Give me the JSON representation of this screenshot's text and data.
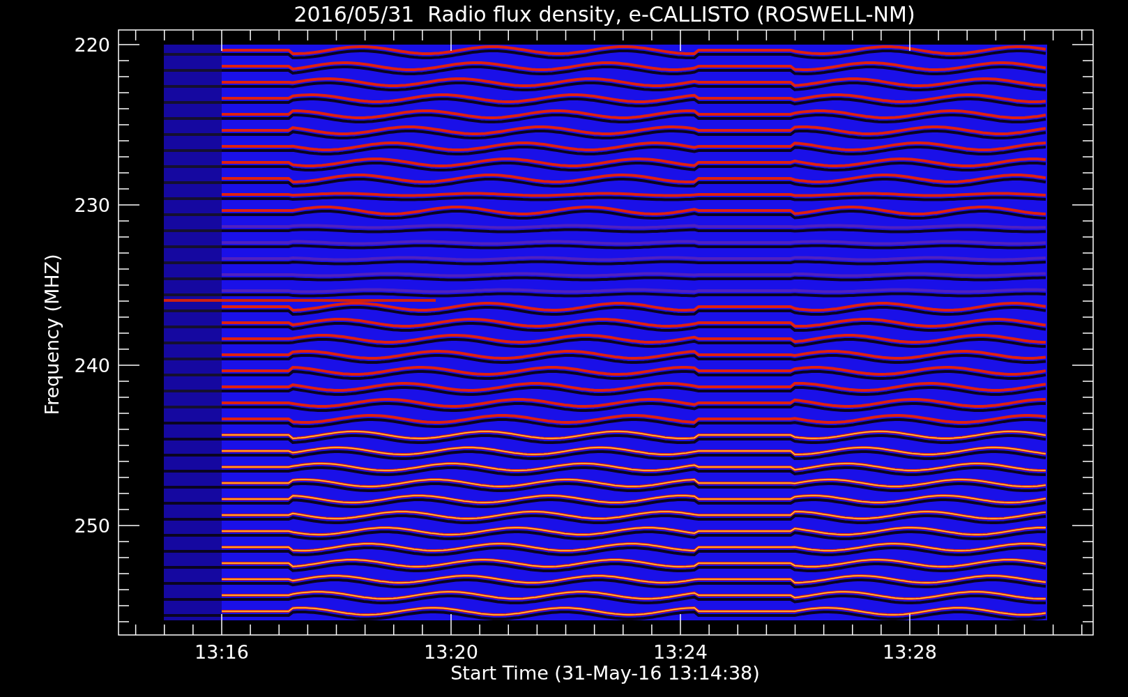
{
  "title": "2016/05/31  Radio flux density, e-CALLISTO (ROSWELL-NM)",
  "y_axis": {
    "label": "Frequency (MHZ)",
    "ticks": [
      "220",
      "230",
      "240",
      "250"
    ]
  },
  "x_axis": {
    "label": "Start Time (31-May-16 13:14:38)",
    "ticks": [
      "13:16",
      "13:20",
      "13:24",
      "13:28"
    ]
  }
}
